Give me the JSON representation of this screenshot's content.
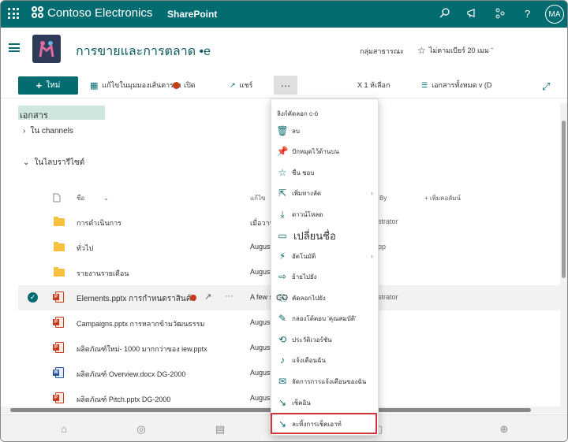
{
  "suite": {
    "brand": "Contoso Electronics",
    "app": "SharePoint",
    "avatar_initials": "MA",
    "icons": [
      "waffle-icon",
      "search-icon",
      "megaphone-icon",
      "share-network-icon",
      "help-icon"
    ]
  },
  "site": {
    "title": "การขายและการตลาด •e",
    "type": "กลุ่มสาธารณะ",
    "follow": "ไม่ตามเบียร์ 20 เมม ˉ"
  },
  "commands": {
    "new": "ใหม่",
    "edit_grid": "แก้ไขในมุมมองเส้นตาราง",
    "open": "เปิด",
    "share": "แชร์",
    "more": "···",
    "selected": "X 1 ห้เลือก",
    "view": "เอกสารทั้งหมด v (D"
  },
  "breadcrumb": "เอกสาร",
  "sections": {
    "channels": "ใน channels",
    "library": "ในไลบรารีไซต์"
  },
  "columns": {
    "name": "ชื่อ",
    "modified": "แก้ไข",
    "modified_by": "By",
    "add_column": "+ เพิ่มคอลัมน์"
  },
  "rows": [
    {
      "name": "การดำเนินการ",
      "icon": "folder",
      "modified": "เมื่อวานนี้",
      "by": "strator",
      "selected": false
    },
    {
      "name": "ทั่วไป",
      "icon": "folder",
      "modified": "August",
      "by": "pp",
      "selected": false
    },
    {
      "name": "รายงานรายเดือน",
      "icon": "folder",
      "modified": "August",
      "by": "",
      "selected": false
    },
    {
      "name": "Elements.pptx การกำหนดราสินค้า",
      "icon": "pptx",
      "modified": "A few s",
      "by": "strator",
      "selected": true
    },
    {
      "name": "Campaigns.pptx การหลากข้ามวัฒนธรรม",
      "icon": "pptx",
      "modified": "August",
      "by": "",
      "selected": false
    },
    {
      "name": "ผลิตภัณฑ์ใหม่- 1000 มากกว่าของ iew.pptx",
      "icon": "pptx",
      "modified": "August",
      "by": "",
      "selected": false
    },
    {
      "name": "ผลิตภัณฑ์ Overview.docx DG-2000",
      "icon": "docx",
      "modified": "August",
      "by": "",
      "selected": false
    },
    {
      "name": "ผลิตภัณฑ์ Pitch.pptx DG-2000",
      "icon": "pptx",
      "modified": "August",
      "by": "",
      "selected": false
    }
  ],
  "menu": [
    {
      "label": "ลิงก์คัดลอก c-ö",
      "icon": "",
      "chevron": false,
      "big": false
    },
    {
      "label": "ลบ",
      "icon": "delete-icon",
      "chevron": false,
      "big": false
    },
    {
      "label": "ปักหมุดไว้ด้านบน",
      "icon": "pin-icon",
      "chevron": false,
      "big": false
    },
    {
      "label": "ชื่น ชอบ",
      "icon": "star-icon",
      "chevron": false,
      "big": false
    },
    {
      "label": "เพิ่มทางลัด",
      "icon": "shortcut-icon",
      "chevron": true,
      "big": false
    },
    {
      "label": "ดาวน์โหลด",
      "icon": "download-icon",
      "chevron": false,
      "big": false
    },
    {
      "label": "เปลี่ยนชื่อ",
      "icon": "rename-icon",
      "chevron": false,
      "big": true
    },
    {
      "label": "อัตโนมัติ",
      "icon": "automate-icon",
      "chevron": true,
      "big": false
    },
    {
      "label": "ย้ายไปยัง",
      "icon": "move-icon",
      "chevron": false,
      "big": false
    },
    {
      "label": "คัดลอกไปยัง",
      "icon": "copy-icon",
      "chevron": false,
      "big": false,
      "prefix": "CO"
    },
    {
      "label": "กลองโต้ตอบ 'คุณสมบัติ'",
      "icon": "properties-icon",
      "chevron": false,
      "big": false
    },
    {
      "label": "ประวัติเวอร์ชัน",
      "icon": "version-icon",
      "chevron": false,
      "big": false
    },
    {
      "label": "แจ้งเตือนฉัน",
      "icon": "bell-icon",
      "chevron": false,
      "big": false
    },
    {
      "label": "จัดการการแจ้งเตือนของฉัน",
      "icon": "manage-alerts-icon",
      "chevron": false,
      "big": false
    },
    {
      "label": "เช็คอิน",
      "icon": "checkin-icon",
      "chevron": false,
      "big": false
    },
    {
      "label": "ละทิ้งการเช็คเอาท์",
      "icon": "discard-checkout-icon",
      "chevron": false,
      "big": false
    }
  ],
  "colors": {
    "accent": "#036c70",
    "highlight": "#d13438"
  }
}
